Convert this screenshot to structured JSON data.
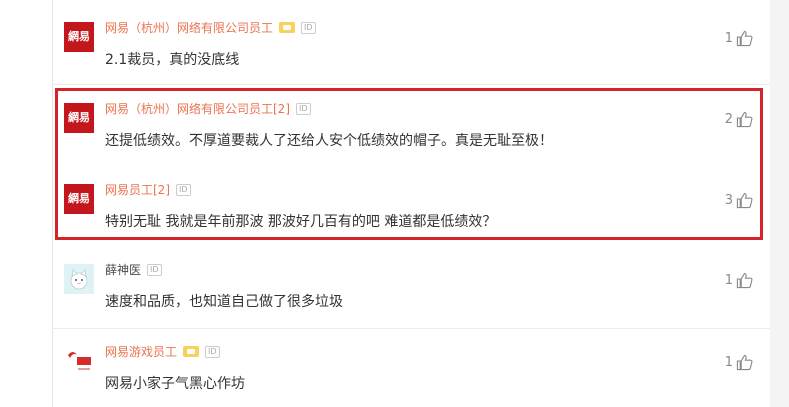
{
  "comments": [
    {
      "name": "网易（杭州）网络有限公司员工",
      "badges": [
        "vip",
        "id"
      ],
      "text": "2.1裁员，真的没底线",
      "likes": "1",
      "avatar": "netease-logo"
    },
    {
      "name": "网易（杭州）网络有限公司员工[2]",
      "badges": [
        "id"
      ],
      "text": "还提低绩效。不厚道要裁人了还给人安个低绩效的帽子。真是无耻至极！",
      "likes": "2",
      "avatar": "netease-logo"
    },
    {
      "name": "网易员工[2]",
      "badges": [
        "id"
      ],
      "text": "特别无耻 我就是年前那波 那波好几百有的吧 难道都是低绩效？",
      "likes": "3",
      "avatar": "netease-logo"
    },
    {
      "name": "薛神医",
      "badges": [
        "id"
      ],
      "text": "速度和品质，也知道自己做了很多垃圾",
      "likes": "1",
      "avatar": "cat-avatar"
    },
    {
      "name": "网易游戏员工",
      "badges": [
        "vip",
        "id"
      ],
      "text": "网易小家子气黑心作坊",
      "likes": "1",
      "avatar": "netease-games-logo"
    }
  ],
  "avatar_text": "網易",
  "id_badge": "ID",
  "colors": {
    "highlight": "#d4232a",
    "name": "#eb7350",
    "netease_red": "#c3171d"
  }
}
